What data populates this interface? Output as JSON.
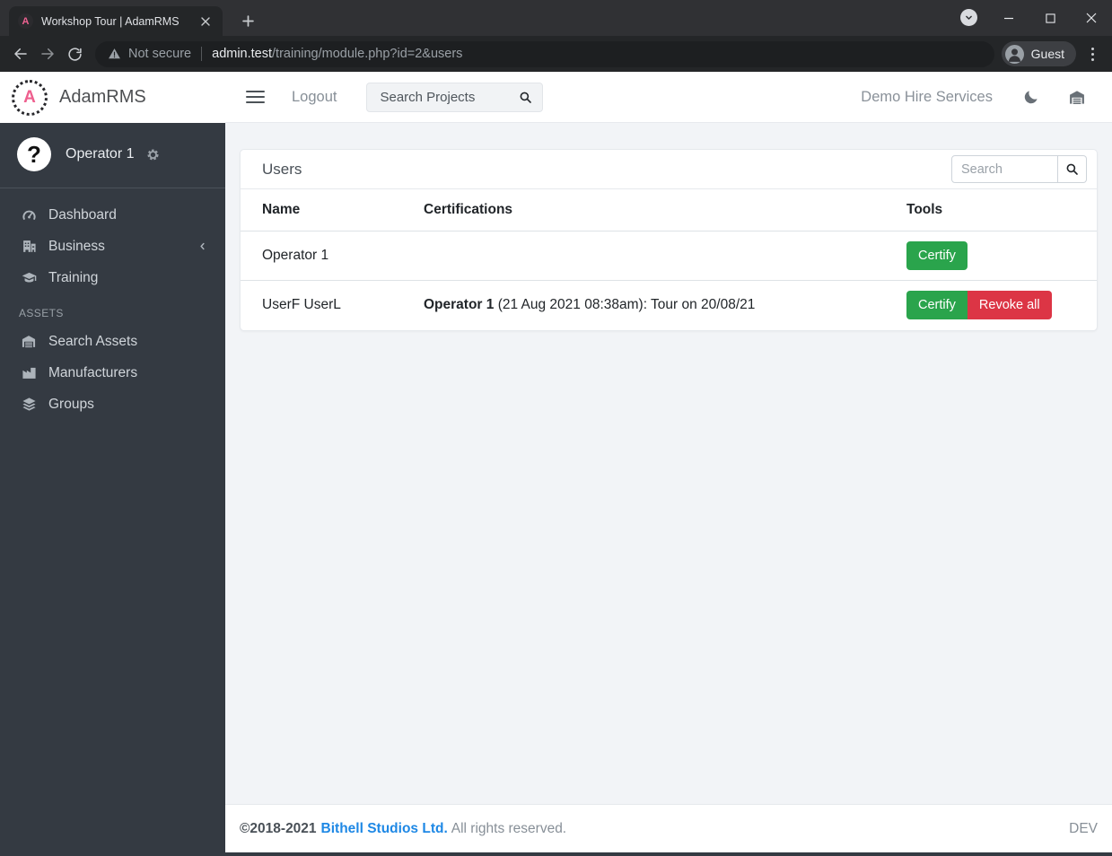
{
  "browser": {
    "tab_title": "Workshop Tour | AdamRMS",
    "security_label": "Not secure",
    "url_host": "admin.test",
    "url_path": "/training/module.php?id=2&users",
    "profile_label": "Guest"
  },
  "sidebar": {
    "brand": "AdamRMS",
    "user_name": "Operator 1",
    "items": [
      {
        "label": "Dashboard"
      },
      {
        "label": "Business"
      },
      {
        "label": "Training"
      }
    ],
    "section_label": "ASSETS",
    "asset_items": [
      {
        "label": "Search Assets"
      },
      {
        "label": "Manufacturers"
      },
      {
        "label": "Groups"
      }
    ]
  },
  "navbar": {
    "logout_label": "Logout",
    "search_placeholder": "Search Projects",
    "org_name": "Demo Hire Services"
  },
  "users_card": {
    "title": "Users",
    "search_placeholder": "Search",
    "columns": [
      "Name",
      "Certifications",
      "Tools"
    ],
    "rows": [
      {
        "name": "Operator 1",
        "cert_bold": "",
        "cert_rest": "",
        "buttons": [
          {
            "label": "Certify",
            "style": "success"
          }
        ]
      },
      {
        "name": "UserF UserL",
        "cert_bold": "Operator 1",
        "cert_rest": " (21 Aug 2021 08:38am): Tour on 20/08/21",
        "buttons": [
          {
            "label": "Certify",
            "style": "success"
          },
          {
            "label": "Revoke all",
            "style": "danger"
          }
        ]
      }
    ]
  },
  "footer": {
    "copyright": "©2018-2021",
    "company": "Bithell Studios Ltd.",
    "rights": "All rights reserved.",
    "env_label": "DEV"
  },
  "colors": {
    "success_green": "#2aa44c",
    "danger_red": "#dc3545",
    "link_blue": "#1e88e5",
    "sidebar_dark": "#343a42",
    "brand_pink": "#ee5f8e"
  }
}
